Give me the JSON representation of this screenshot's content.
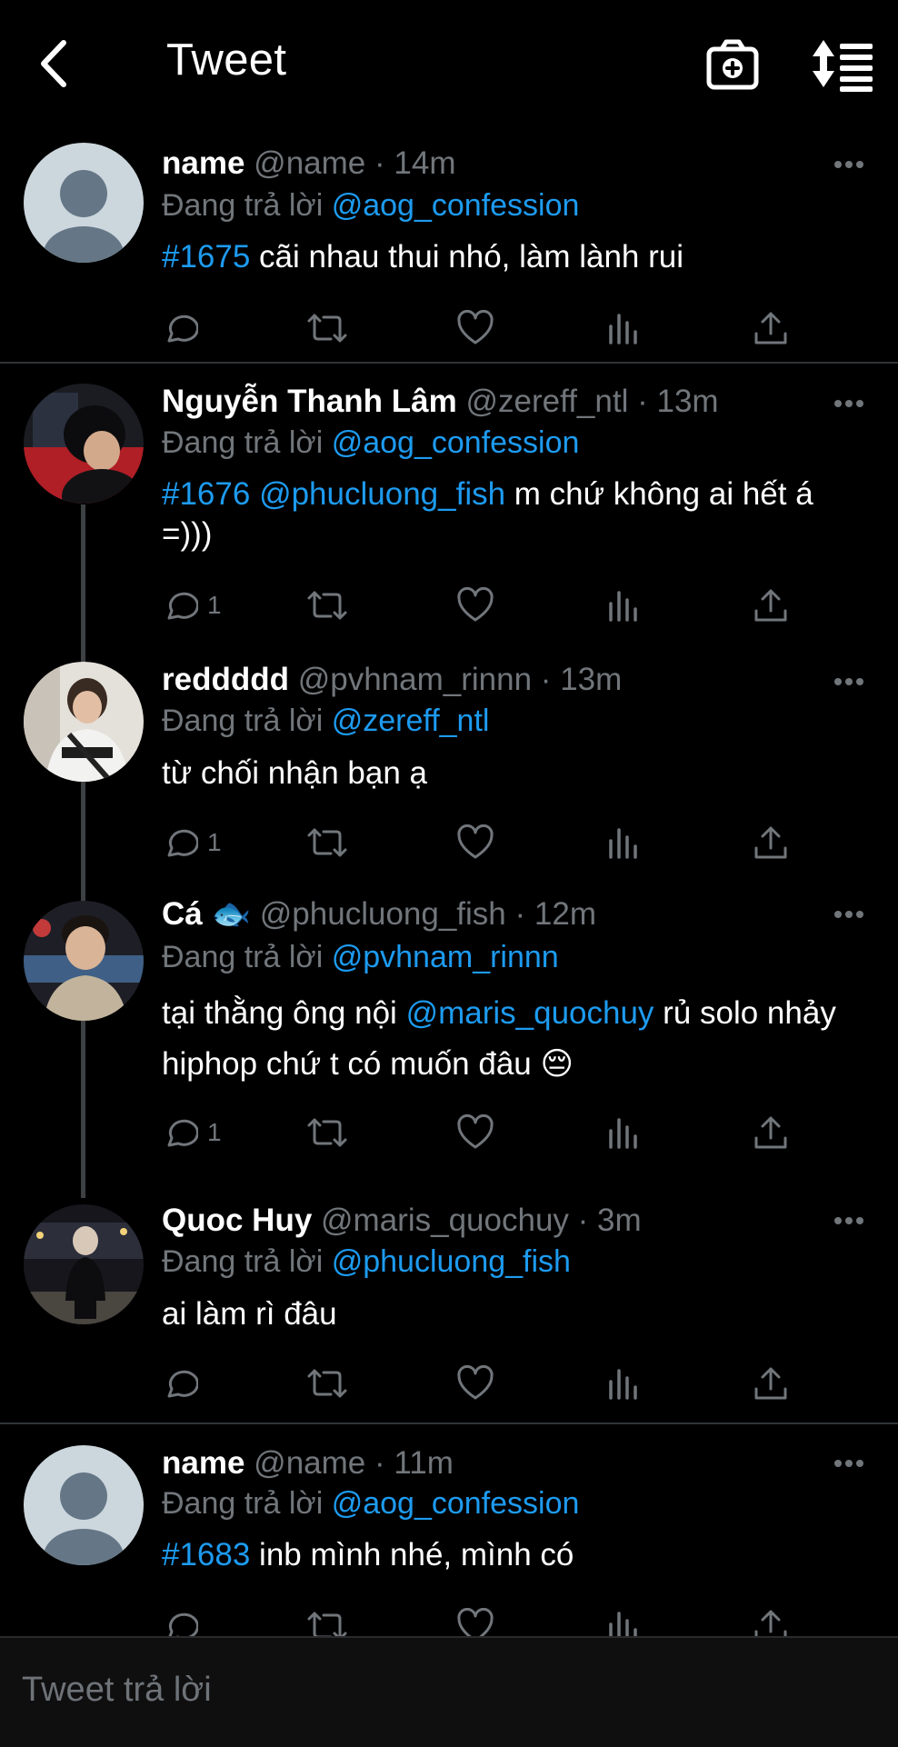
{
  "header": {
    "title": "Tweet",
    "back_icon": "chevron-left-icon",
    "camera_icon": "camera-plus-icon",
    "sort_icon": "sort-list-icon"
  },
  "colors": {
    "background": "#000000",
    "accent": "#1d9bf0",
    "muted": "#71767b",
    "divider": "#2f3336"
  },
  "tweets": [
    {
      "name": "name",
      "handle": "@name",
      "time": "14m",
      "reply_prefix": "Đang trả lời",
      "reply_to": "@aog_confession",
      "tag": "#1675",
      "text": " cãi nhau thui nhó, làm lành rui",
      "reply_count": ""
    },
    {
      "name": "Nguyễn Thanh Lâm",
      "handle": "@zereff_ntl",
      "time": "13m",
      "reply_prefix": "Đang trả lời",
      "reply_to": "@aog_confession",
      "tag": "#1676",
      "mention": "@phucluong_fish",
      "text": " m chứ không ai hết á =)))",
      "reply_count": "1"
    },
    {
      "name": "reddddd",
      "handle": "@pvhnam_rinnn",
      "time": "13m",
      "reply_prefix": "Đang trả lời",
      "reply_to": "@zereff_ntl",
      "text": "từ chối nhận bạn ạ",
      "reply_count": "1"
    },
    {
      "name": "Cá 🐟",
      "handle": "@phucluong_fish",
      "time": "12m",
      "reply_prefix": "Đang trả lời",
      "reply_to": "@pvhnam_rinnn",
      "text_before": "tại thằng ông nội ",
      "mention": "@maris_quochuy",
      "text_after": " rủ solo nhảy hiphop chứ t có muốn đâu 😔",
      "reply_count": "1"
    },
    {
      "name": "Quoc Huy",
      "handle": "@maris_quochuy",
      "time": "3m",
      "reply_prefix": "Đang trả lời",
      "reply_to": "@phucluong_fish",
      "text": "ai làm rì đâu",
      "reply_count": ""
    },
    {
      "name": "name",
      "handle": "@name",
      "time": "11m",
      "reply_prefix": "Đang trả lời",
      "reply_to": "@aog_confession",
      "tag": "#1683",
      "text": " inb mình nhé, mình có",
      "reply_count": ""
    }
  ],
  "composer": {
    "placeholder": "Tweet trả lời"
  }
}
